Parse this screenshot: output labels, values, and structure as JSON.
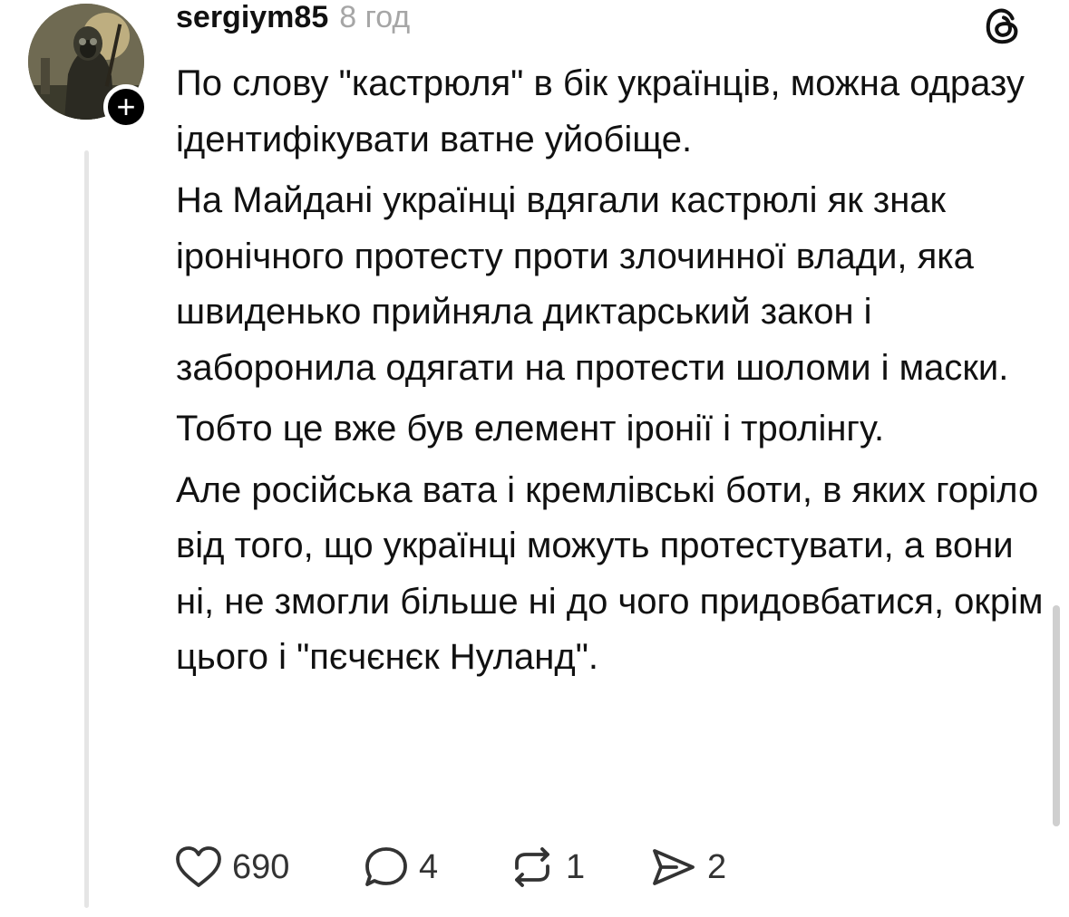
{
  "post": {
    "author": {
      "username": "sergiym85",
      "avatar_icon": "avatar-image",
      "follow_icon": "plus-icon",
      "follow_glyph": "+"
    },
    "timestamp": "8 год",
    "app_icon": "threads-logo-icon",
    "paragraphs": [
      "По слову \"кастрюля\" в бік українців, можна одразу ідентифікувати ватне уйобіще.",
      "На Майдані українці вдягали кастрюлі як знак іронічного протесту проти злочинної влади, яка швиденько прийняла диктарський закон і заборонила одягати на протести шоломи і маски.",
      "Тобто це вже був елемент іронії і тролінгу.",
      "Але російська вата і кремлівські боти, в яких горіло від того, що українці можуть протестувати, а вони ні, не змогли більше ні до чого придовбатися, окрім цього і \"пєчєнєк Нуланд\"."
    ],
    "actions": {
      "like": {
        "icon": "heart-icon",
        "count": "690"
      },
      "reply": {
        "icon": "comment-icon",
        "count": "4"
      },
      "repost": {
        "icon": "repost-icon",
        "count": "1"
      },
      "share": {
        "icon": "share-icon",
        "count": "2"
      }
    }
  },
  "colors": {
    "text": "#111111",
    "secondary_text": "#a6a6a6",
    "thread_line": "#e5e5e5",
    "badge": "#000000"
  }
}
